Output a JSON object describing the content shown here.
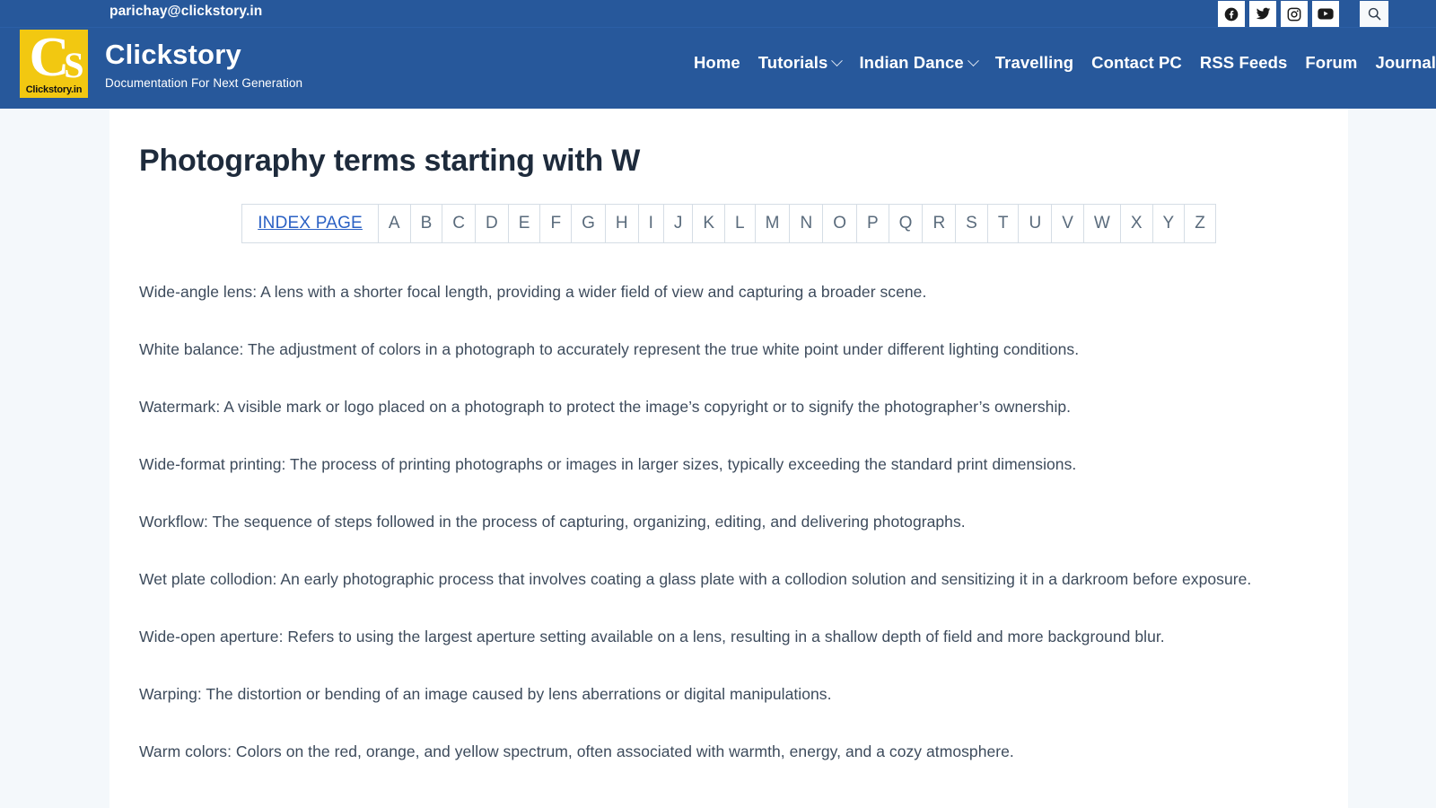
{
  "topbar": {
    "email": "parichay@clickstory.in",
    "social": [
      {
        "name": "facebook-icon",
        "label": "Facebook"
      },
      {
        "name": "twitter-icon",
        "label": "Twitter"
      },
      {
        "name": "instagram-icon",
        "label": "Instagram"
      },
      {
        "name": "youtube-icon",
        "label": "YouTube"
      }
    ],
    "search_label": "Search"
  },
  "header": {
    "logo_letters": "CS",
    "logo_c": "C",
    "logo_s": "S",
    "logo_word": "Clickstory.in",
    "brand_title": "Clickstory",
    "brand_tagline": "Documentation For Next Generation",
    "nav": [
      {
        "label": "Home",
        "dropdown": false
      },
      {
        "label": "Tutorials",
        "dropdown": true
      },
      {
        "label": "Indian Dance",
        "dropdown": true
      },
      {
        "label": "Travelling",
        "dropdown": false
      },
      {
        "label": "Contact PC",
        "dropdown": false
      },
      {
        "label": "RSS Feeds",
        "dropdown": false
      },
      {
        "label": "Forum",
        "dropdown": false
      },
      {
        "label": "Journal",
        "dropdown": false
      }
    ]
  },
  "main": {
    "page_title": "Photography terms starting with W",
    "index_link_label": "INDEX PAGE",
    "letters": [
      "A",
      "B",
      "C",
      "D",
      "E",
      "F",
      "G",
      "H",
      "I",
      "J",
      "K",
      "L",
      "M",
      "N",
      "O",
      "P",
      "Q",
      "R",
      "S",
      "T",
      "U",
      "V",
      "W",
      "X",
      "Y",
      "Z"
    ],
    "terms": [
      "Wide-angle lens: A lens with a shorter focal length, providing a wider field of view and capturing a broader scene.",
      "White balance: The adjustment of colors in a photograph to accurately represent the true white point under different lighting conditions.",
      "Watermark: A visible mark or logo placed on a photograph to protect the image’s copyright or to signify the photographer’s ownership.",
      "Wide-format printing: The process of printing photographs or images in larger sizes, typically exceeding the standard print dimensions.",
      "Workflow: The sequence of steps followed in the process of capturing, organizing, editing, and delivering photographs.",
      "Wet plate collodion: An early photographic process that involves coating a glass plate with a collodion solution and sensitizing it in a darkroom before exposure.",
      "Wide-open aperture: Refers to using the largest aperture setting available on a lens, resulting in a shallow depth of field and more background blur.",
      "Warping: The distortion or bending of an image caused by lens aberrations or digital manipulations.",
      "Warm colors: Colors on the red, orange, and yellow spectrum, often associated with warmth, energy, and a cozy atmosphere."
    ]
  },
  "colors": {
    "header_blue": "#27589b",
    "logo_yellow": "#f2c811",
    "page_bg": "#f4f8fb",
    "sheet_bg": "#ffffff",
    "link_blue": "#2b61c4",
    "body_text": "#3d4b5c",
    "title_text": "#1e2b3c"
  }
}
